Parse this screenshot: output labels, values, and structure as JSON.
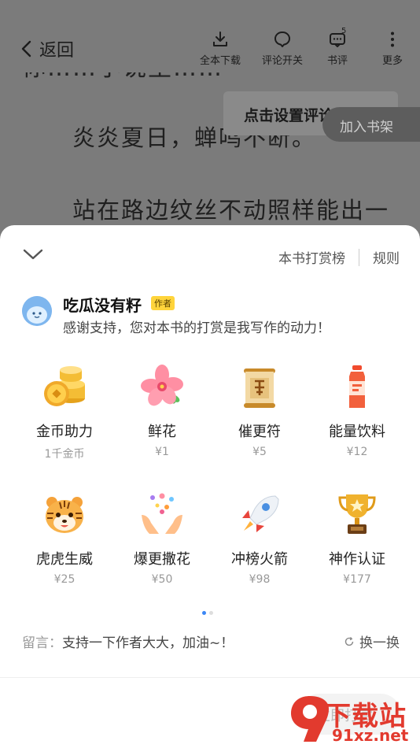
{
  "reader": {
    "text_cut": "你……小说里……",
    "line1": "炎炎夏日，蝉鸣不断。",
    "line2": "站在路边纹丝不动照样能出一"
  },
  "topbar": {
    "back_label": "返回",
    "tools": [
      {
        "label": "全本下载",
        "icon": "download-icon"
      },
      {
        "label": "评论开关",
        "icon": "comment-icon"
      },
      {
        "label": "书评",
        "icon": "review-icon",
        "count": "5"
      },
      {
        "label": "更多",
        "icon": "more-icon"
      }
    ]
  },
  "tip": "点击设置评论开关",
  "shelf_label": "加入书架",
  "sheet": {
    "ranking_link": "本书打赏榜",
    "rules_link": "规则",
    "author": {
      "name": "吃瓜没有籽",
      "badge": "作者",
      "message": "感谢支持，您对本书的打赏是我写作的动力！"
    },
    "gifts": [
      {
        "name": "金币助力",
        "price": "1千金币",
        "icon": "gold-coins-icon"
      },
      {
        "name": "鲜花",
        "price": "¥1",
        "icon": "flower-icon"
      },
      {
        "name": "催更符",
        "price": "¥5",
        "icon": "urge-scroll-icon"
      },
      {
        "name": "能量饮料",
        "price": "¥12",
        "icon": "energy-drink-icon"
      },
      {
        "name": "虎虎生威",
        "price": "¥25",
        "icon": "tiger-icon"
      },
      {
        "name": "爆更撒花",
        "price": "¥50",
        "icon": "confetti-hands-icon"
      },
      {
        "name": "冲榜火箭",
        "price": "¥98",
        "icon": "rocket-icon"
      },
      {
        "name": "神作认证",
        "price": "¥177",
        "icon": "trophy-icon"
      }
    ],
    "message_prefix": "留言：",
    "message_text": "支持一下作者大大，加油~！",
    "swap_label": "换一换",
    "bottom_button": "立即打赏"
  },
  "watermark": {
    "big": "下载站",
    "small": "91xz.net"
  },
  "colors": {
    "accent_blue": "#3b87f5",
    "badge_yellow": "#ffd43b",
    "watermark_red": "#e23a2e"
  }
}
